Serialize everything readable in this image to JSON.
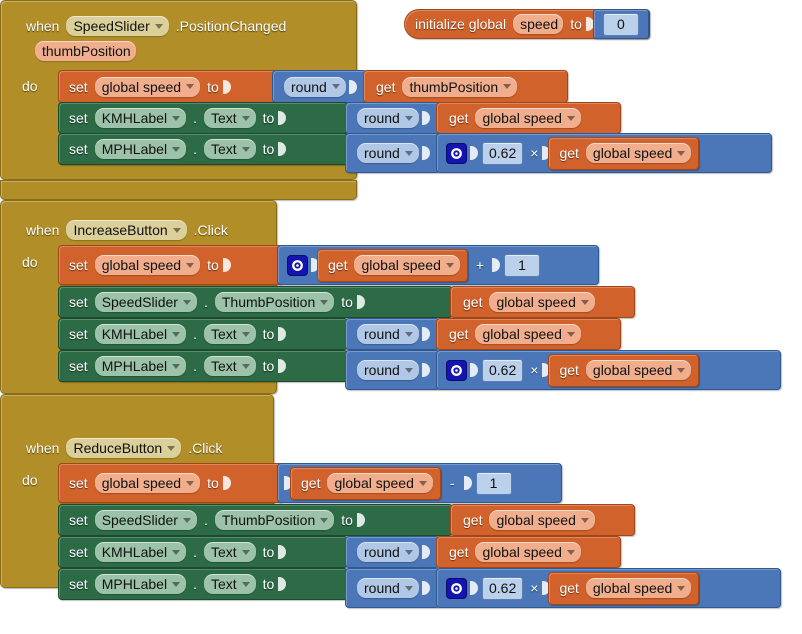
{
  "app": {
    "editor": "MIT App Inventor Blocks Editor",
    "background": "#ffffff"
  },
  "colors": {
    "event_block": "#B18E28",
    "variable_block": "#D1622B",
    "component_setter": "#2C6B46",
    "math_block": "#4B77B8",
    "mutator_icon": "#1414B0"
  },
  "words": {
    "when": "when",
    "do": "do",
    "set": "set",
    "to": "to",
    "get": "get",
    "dot": ".",
    "round": "round",
    "initialize_global": "initialize global",
    "plus": "+",
    "minus": "-",
    "times": "×"
  },
  "global_init": {
    "label": "initialize global",
    "variable": "speed",
    "to": "to",
    "value": "0"
  },
  "blocks": [
    {
      "id": "speedslider-positionchanged",
      "event": {
        "when": "when",
        "component": "SpeedSlider",
        "method": ".PositionChanged",
        "parameter": "thumbPosition",
        "do": "do"
      },
      "statements": [
        {
          "kind": "set-global",
          "set": "set",
          "target": "global speed",
          "to": "to",
          "value": {
            "kind": "round",
            "name": "round",
            "arg": {
              "kind": "get",
              "get": "get",
              "name": "thumbPosition"
            }
          }
        },
        {
          "kind": "set-component",
          "set": "set",
          "component": "KMHLabel",
          "dot": ".",
          "property": "Text",
          "to": "to",
          "value": {
            "kind": "round",
            "name": "round",
            "arg": {
              "kind": "get",
              "get": "get",
              "name": "global speed"
            }
          }
        },
        {
          "kind": "set-component",
          "set": "set",
          "component": "MPHLabel",
          "dot": ".",
          "property": "Text",
          "to": "to",
          "value": {
            "kind": "round",
            "name": "round",
            "arg": {
              "kind": "multiply",
              "operator": "×",
              "left": "0.62",
              "right": {
                "kind": "get",
                "get": "get",
                "name": "global speed"
              }
            }
          }
        }
      ]
    },
    {
      "id": "increasebutton-click",
      "event": {
        "when": "when",
        "component": "IncreaseButton",
        "method": ".Click",
        "parameter": null,
        "do": "do"
      },
      "statements": [
        {
          "kind": "set-global",
          "set": "set",
          "target": "global speed",
          "to": "to",
          "value": {
            "kind": "add",
            "operator": "+",
            "left": {
              "kind": "get",
              "get": "get",
              "name": "global speed"
            },
            "right": "1"
          }
        },
        {
          "kind": "set-component",
          "set": "set",
          "component": "SpeedSlider",
          "dot": ".",
          "property": "ThumbPosition",
          "to": "to",
          "value": {
            "kind": "get",
            "get": "get",
            "name": "global speed"
          }
        },
        {
          "kind": "set-component",
          "set": "set",
          "component": "KMHLabel",
          "dot": ".",
          "property": "Text",
          "to": "to",
          "value": {
            "kind": "round",
            "name": "round",
            "arg": {
              "kind": "get",
              "get": "get",
              "name": "global speed"
            }
          }
        },
        {
          "kind": "set-component",
          "set": "set",
          "component": "MPHLabel",
          "dot": ".",
          "property": "Text",
          "to": "to",
          "value": {
            "kind": "round",
            "name": "round",
            "arg": {
              "kind": "multiply",
              "operator": "×",
              "left": "0.62",
              "right": {
                "kind": "get",
                "get": "get",
                "name": "global speed"
              }
            }
          }
        }
      ]
    },
    {
      "id": "reducebutton-click",
      "event": {
        "when": "when",
        "component": "ReduceButton",
        "method": ".Click",
        "parameter": null,
        "do": "do"
      },
      "statements": [
        {
          "kind": "set-global",
          "set": "set",
          "target": "global speed",
          "to": "to",
          "value": {
            "kind": "subtract",
            "operator": "-",
            "left": {
              "kind": "get",
              "get": "get",
              "name": "global speed"
            },
            "right": "1"
          }
        },
        {
          "kind": "set-component",
          "set": "set",
          "component": "SpeedSlider",
          "dot": ".",
          "property": "ThumbPosition",
          "to": "to",
          "value": {
            "kind": "get",
            "get": "get",
            "name": "global speed"
          }
        },
        {
          "kind": "set-component",
          "set": "set",
          "component": "KMHLabel",
          "dot": ".",
          "property": "Text",
          "to": "to",
          "value": {
            "kind": "round",
            "name": "round",
            "arg": {
              "kind": "get",
              "get": "get",
              "name": "global speed"
            }
          }
        },
        {
          "kind": "set-component",
          "set": "set",
          "component": "MPHLabel",
          "dot": ".",
          "property": "Text",
          "to": "to",
          "value": {
            "kind": "round",
            "name": "round",
            "arg": {
              "kind": "multiply",
              "operator": "×",
              "left": "0.62",
              "right": {
                "kind": "get",
                "get": "get",
                "name": "global speed"
              }
            }
          }
        }
      ]
    }
  ]
}
